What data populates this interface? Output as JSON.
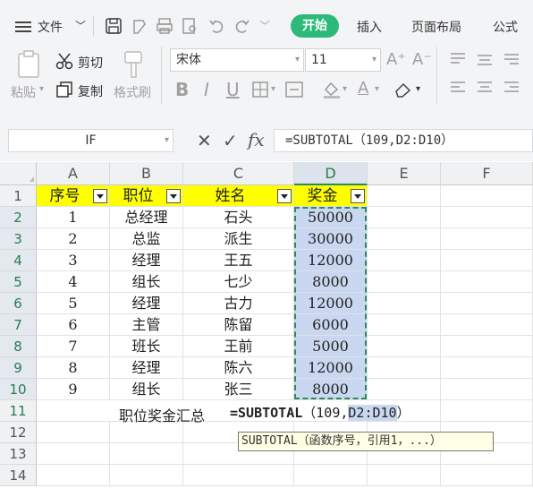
{
  "menu": {
    "file_label": "文件",
    "tabs": [
      "开始",
      "插入",
      "页面布局",
      "公式"
    ]
  },
  "ribbon": {
    "paste": "粘贴",
    "cut": "剪切",
    "copy": "复制",
    "format_painter": "格式刷",
    "font_name": "宋体",
    "font_size": "11"
  },
  "formula_bar": {
    "name_box": "IF",
    "formula": "=SUBTOTAL（109,D2:D10）"
  },
  "sheet": {
    "columns": [
      "A",
      "B",
      "C",
      "D",
      "E",
      "F"
    ],
    "row_numbers": [
      "1",
      "2",
      "3",
      "4",
      "5",
      "6",
      "7",
      "8",
      "9",
      "10",
      "11",
      "12",
      "13",
      "14"
    ],
    "header": [
      "序号",
      "职位",
      "姓名",
      "奖金"
    ],
    "rows": [
      [
        "1",
        "总经理",
        "石头",
        "50000"
      ],
      [
        "2",
        "总监",
        "派生",
        "30000"
      ],
      [
        "3",
        "经理",
        "王五",
        "12000"
      ],
      [
        "4",
        "组长",
        "七少",
        "8000"
      ],
      [
        "5",
        "经理",
        "古力",
        "12000"
      ],
      [
        "6",
        "主管",
        "陈留",
        "6000"
      ],
      [
        "7",
        "班长",
        "王前",
        "5000"
      ],
      [
        "8",
        "经理",
        "陈六",
        "12000"
      ],
      [
        "9",
        "组长",
        "张三",
        "8000"
      ]
    ],
    "summary_label": "职位奖金汇总",
    "editing_formula": "=SUBTOTAL（109,D2:D10）",
    "tooltip": "SUBTOTAL（函数序号，引用1，...）"
  },
  "colors": {
    "accent": "#2db97a",
    "header_fill": "#ffff00",
    "selection_fill": "#c9d7f0"
  }
}
